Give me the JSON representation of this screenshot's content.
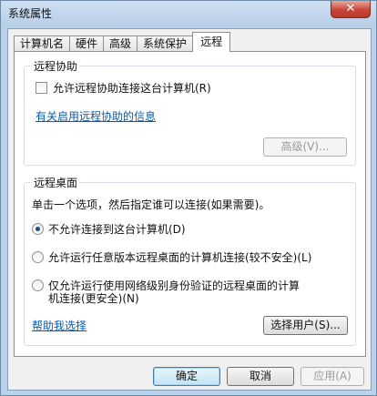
{
  "window": {
    "title": "系统属性",
    "close_symbol": "✕"
  },
  "tabs": [
    {
      "label": "计算机名",
      "active": false
    },
    {
      "label": "硬件",
      "active": false
    },
    {
      "label": "高级",
      "active": false
    },
    {
      "label": "系统保护",
      "active": false
    },
    {
      "label": "远程",
      "active": true
    }
  ],
  "remote_assistance": {
    "title": "远程协助",
    "allow_checkbox": {
      "label": "允许远程协助连接这台计算机(R)",
      "checked": false
    },
    "info_link": "有关启用远程协助的信息",
    "advanced_button": "高级(V)..."
  },
  "remote_desktop": {
    "title": "远程桌面",
    "instruction": "单击一个选项，然后指定谁可以连接(如果需要)。",
    "options": [
      {
        "label": "不允许连接到这台计算机(D)",
        "checked": true
      },
      {
        "label": "允许运行任意版本远程桌面的计算机连接(较不安全)(L)",
        "checked": false
      },
      {
        "label_line1": "仅允许运行使用网络级别身份验证的远程桌面的计算",
        "label_line2": "机连接(更安全)(N)",
        "checked": false
      }
    ],
    "help_link": "帮助我选择",
    "select_users_button": "选择用户(S)..."
  },
  "footer": {
    "ok": "确定",
    "cancel": "取消",
    "apply": "应用(A)"
  }
}
